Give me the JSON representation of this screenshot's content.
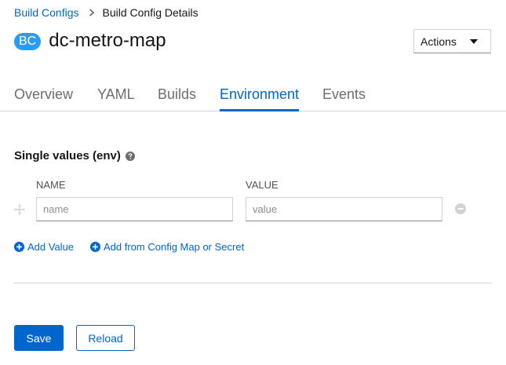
{
  "breadcrumb": {
    "parent": "Build Configs",
    "current": "Build Config Details"
  },
  "header": {
    "badge": "BC",
    "title": "dc-metro-map",
    "actions_label": "Actions"
  },
  "tabs": [
    {
      "label": "Overview",
      "active": false
    },
    {
      "label": "YAML",
      "active": false
    },
    {
      "label": "Builds",
      "active": false
    },
    {
      "label": "Environment",
      "active": true
    },
    {
      "label": "Events",
      "active": false
    }
  ],
  "env": {
    "section_title": "Single values (env)",
    "name_header": "NAME",
    "value_header": "VALUE",
    "name_placeholder": "name",
    "value_placeholder": "value",
    "add_value": "Add Value",
    "add_from_config": "Add from Config Map or Secret"
  },
  "footer": {
    "save": "Save",
    "reload": "Reload"
  },
  "colors": {
    "accent": "#0066cc",
    "badge": "#2b9af3"
  }
}
